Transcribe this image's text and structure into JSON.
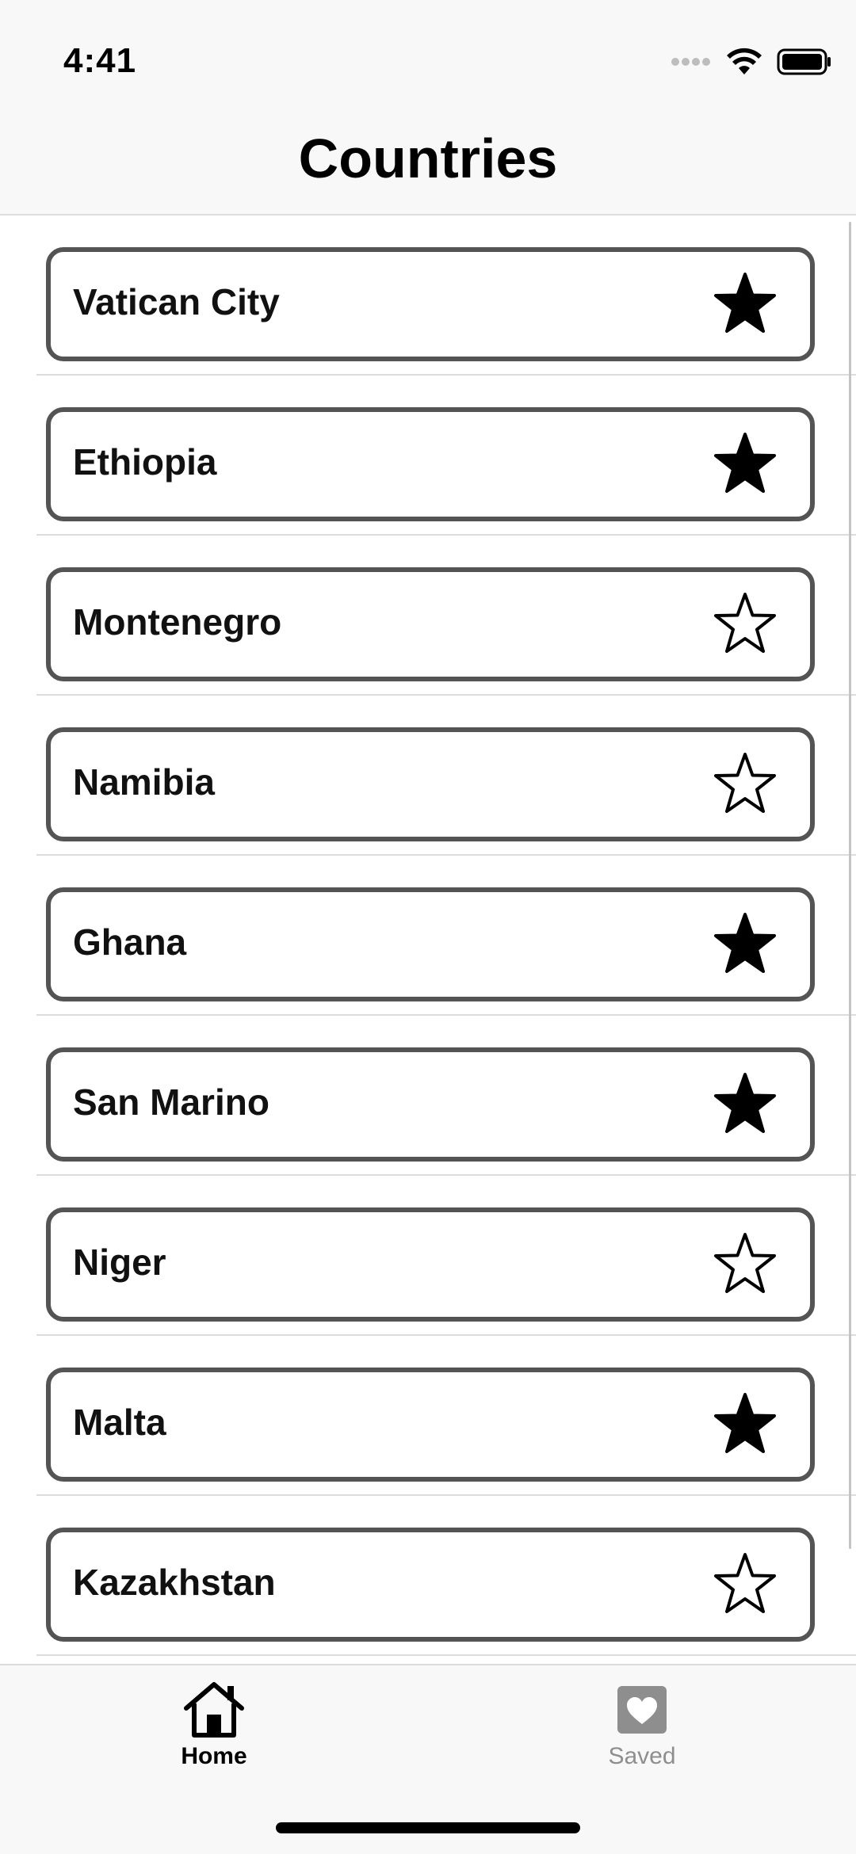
{
  "status_bar": {
    "time": "4:41",
    "icons": [
      "cellular-dots-icon",
      "wifi-icon",
      "battery-icon"
    ]
  },
  "header": {
    "title": "Countries"
  },
  "countries": [
    {
      "name": "Vatican City",
      "favorite": true
    },
    {
      "name": "Ethiopia",
      "favorite": true
    },
    {
      "name": "Montenegro",
      "favorite": false
    },
    {
      "name": "Namibia",
      "favorite": false
    },
    {
      "name": "Ghana",
      "favorite": true
    },
    {
      "name": "San Marino",
      "favorite": true
    },
    {
      "name": "Niger",
      "favorite": false
    },
    {
      "name": "Malta",
      "favorite": true
    },
    {
      "name": "Kazakhstan",
      "favorite": false
    }
  ],
  "tab_bar": {
    "tabs": [
      {
        "label": "Home",
        "icon": "house-icon",
        "selected": true
      },
      {
        "label": "Saved",
        "icon": "heart-icon",
        "selected": false
      }
    ]
  },
  "colors": {
    "card_border": "#545454",
    "tab_active": "#000000",
    "tab_inactive": "#8e8e8e",
    "bar_background": "#f8f8f8"
  }
}
